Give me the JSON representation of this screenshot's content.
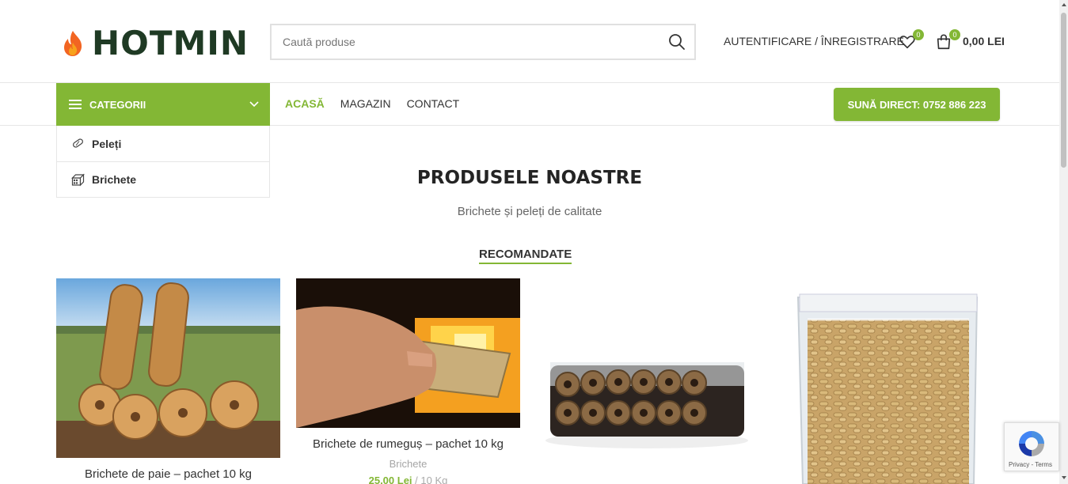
{
  "header": {
    "logo_text": "HOTMIN",
    "search_placeholder": "Caută produse",
    "account_label": "AUTENTIFICARE / ÎNREGISTRARE",
    "wishlist_count": "0",
    "cart_count": "0",
    "cart_total": "0,00 LEI"
  },
  "nav": {
    "categories_label": "CATEGORII",
    "menu": [
      "ACASĂ",
      "MAGAZIN",
      "CONTACT"
    ],
    "call_label": "SUNĂ DIRECT: 0752 886 223"
  },
  "categories": [
    {
      "label": "Peleți",
      "icon": "pellet-icon"
    },
    {
      "label": "Brichete",
      "icon": "briquette-icon"
    }
  ],
  "section": {
    "title": "PRODUSELE NOASTRE",
    "subtitle": "Brichete și peleți de calitate",
    "tab": "RECOMANDATE"
  },
  "products": [
    {
      "name": "Brichete de paie – pachet 10 kg"
    },
    {
      "name": "Brichete de rumeguș – pachet 10 kg",
      "category": "Brichete",
      "price": "25,00 Lei",
      "unit": "/ 10 Kg"
    },
    {
      "name": ""
    },
    {
      "name": ""
    }
  ],
  "recaptcha": {
    "links": "Privacy - Terms"
  },
  "colors": {
    "accent": "#83b735",
    "logo": "#1f3a24",
    "flame": "#f26522"
  }
}
